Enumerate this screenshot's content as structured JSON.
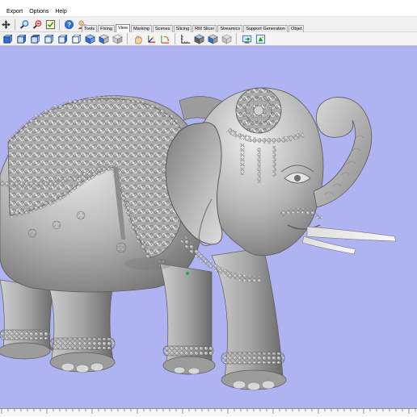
{
  "menu": [
    "Export",
    "Options",
    "Help"
  ],
  "tabs": [
    "Tools",
    "Fixing",
    "View",
    "Marking",
    "Scenes",
    "Slicing",
    "RM Slicer",
    "Streamics",
    "Support Generation",
    "Objet"
  ],
  "active_tab": "View",
  "colors": {
    "viewport_bg": "#b0b3f2",
    "model_gray": "#9a9a9a",
    "toolbar_bg": "#f0f0f0",
    "accent_blue": "#2f6fd3"
  },
  "toolbar_icons": [
    "move-icon",
    "search-icon",
    "zoom-out-icon",
    "checklist-icon",
    "help-icon",
    "person-icon"
  ],
  "view_icons": [
    "view-front-icon",
    "view-back-icon",
    "view-left-icon",
    "view-right-icon",
    "view-top-icon",
    "view-bottom-icon",
    "view-iso-icon",
    "view-iso-alt-icon",
    "view-perspective-icon",
    "pan-icon",
    "axes-icon",
    "rotate-axes-icon",
    "ruler-icon",
    "shade-icon",
    "cube-icon",
    "cube-alt-icon",
    "screenshot-icon",
    "fit-view-icon"
  ],
  "model": {
    "name": "elephant-model"
  }
}
